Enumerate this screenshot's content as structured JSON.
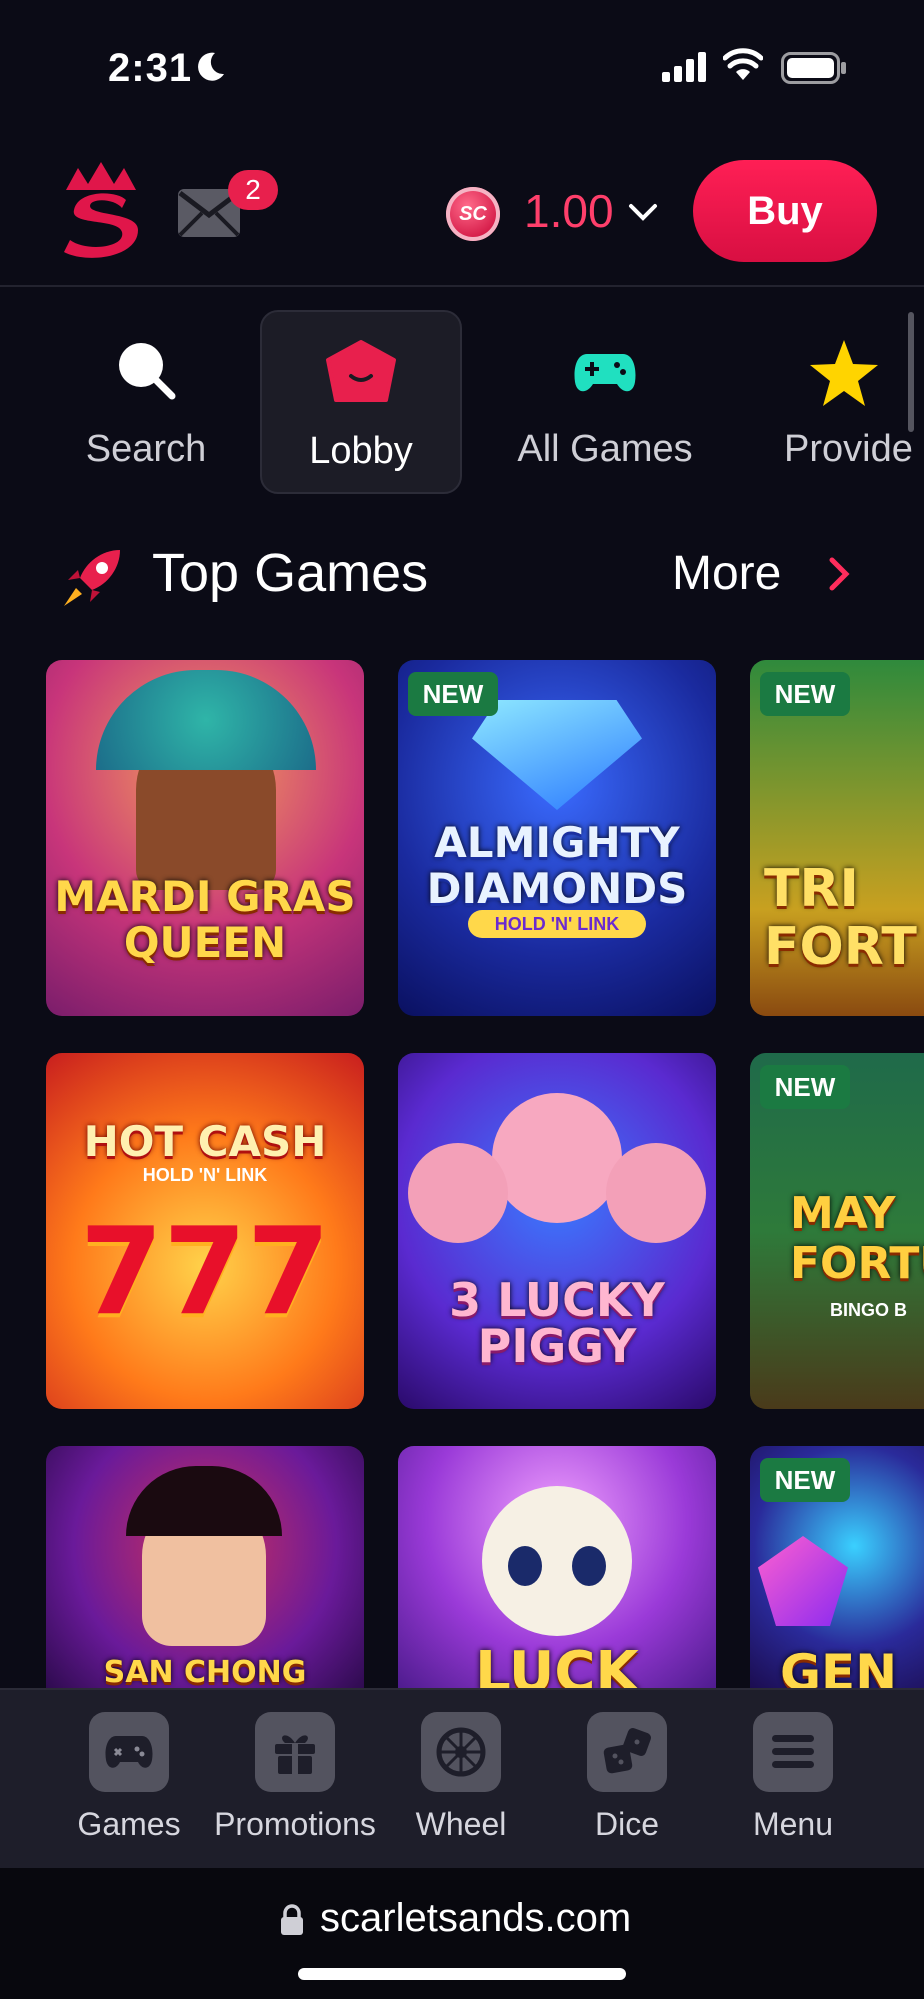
{
  "status_bar": {
    "time": "2:31"
  },
  "header": {
    "logo": "scarlet-s-crown-logo",
    "mail_badge": "2",
    "coin_label": "SC",
    "balance": "1.00",
    "buy_label": "Buy"
  },
  "tabs": [
    {
      "label": "Search",
      "icon": "search-icon"
    },
    {
      "label": "Lobby",
      "icon": "lobby-icon",
      "active": true
    },
    {
      "label": "All Games",
      "icon": "gamepad-icon"
    },
    {
      "label": "Provide",
      "icon": "star-icon"
    }
  ],
  "section": {
    "title": "Top Games",
    "more_label": "More"
  },
  "games": [
    {
      "title": "MARDI GRAS QUEEN",
      "new": false
    },
    {
      "title": "ALMIGHTY DIAMONDS",
      "subtitle": "HOLD 'N' LINK",
      "new": true
    },
    {
      "title": "TRI FORT",
      "new": true
    },
    {
      "title": "HOT CASH",
      "subtitle": "HOLD 'N' LINK",
      "new": false
    },
    {
      "title": "3 LUCKY PIGGY",
      "new": false
    },
    {
      "title": "MAY FORTU",
      "subtitle": "BINGO B",
      "new": true
    },
    {
      "title": "SAN CHONG",
      "new": false
    },
    {
      "title": "LUCK",
      "new": false
    },
    {
      "title": "GEN",
      "new": true
    }
  ],
  "new_badge": "NEW",
  "bottom_nav": [
    {
      "label": "Games",
      "icon": "gamepad-icon"
    },
    {
      "label": "Promotions",
      "icon": "gift-icon"
    },
    {
      "label": "Wheel",
      "icon": "wheel-icon"
    },
    {
      "label": "Dice",
      "icon": "dice-icon"
    },
    {
      "label": "Menu",
      "icon": "menu-icon"
    }
  ],
  "url_bar": {
    "url": "scarletsands.com"
  },
  "colors": {
    "accent": "#e8204d",
    "background": "#0b0b16",
    "nav": "#1e1e2a"
  }
}
